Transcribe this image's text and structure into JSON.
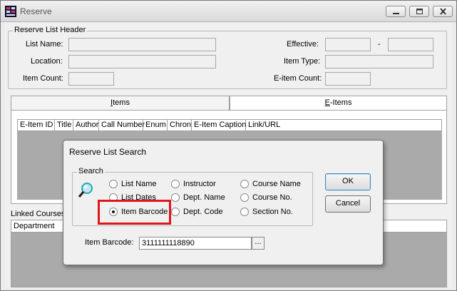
{
  "window": {
    "title": "Reserve"
  },
  "header_group": {
    "title": "Reserve List Header",
    "list_name_label": "List Name:",
    "location_label": "Location:",
    "item_count_label": "Item Count:",
    "effective_label": "Effective:",
    "effective_separator": "-",
    "item_type_label": "Item Type:",
    "eitem_count_label": "E-item Count:"
  },
  "tabs": [
    {
      "label_u": "I",
      "label_rest": "tems",
      "active": false
    },
    {
      "label_u": "E",
      "label_pre": "",
      "label_rest": "-Items",
      "active": true
    }
  ],
  "eitems_grid": {
    "columns": [
      "E-Item ID",
      "Title",
      "Author",
      "Call Number",
      "Enum",
      "Chron",
      "E-Item Caption",
      "Link/URL"
    ]
  },
  "linked_courses": {
    "label": "Linked Courses",
    "columns": [
      "Department"
    ]
  },
  "dialog": {
    "title": "Reserve List Search",
    "group_title": "Search",
    "options": {
      "list_name": "List Name",
      "list_dates": "List Dates",
      "item_barcode": "Item Barcode",
      "instructor": "Instructor",
      "dept_name": "Dept. Name",
      "dept_code": "Dept. Code",
      "course_name": "Course Name",
      "course_no": "Course No.",
      "section_no": "Section No."
    },
    "selected_option": "Item Barcode",
    "ok_label": "OK",
    "cancel_label": "Cancel",
    "barcode_label": "Item Barcode:",
    "barcode_value": "3111111118890",
    "browse_label": "..."
  },
  "colors": {
    "highlight": "#e0151b",
    "grid_background": "#aaaaaa"
  }
}
